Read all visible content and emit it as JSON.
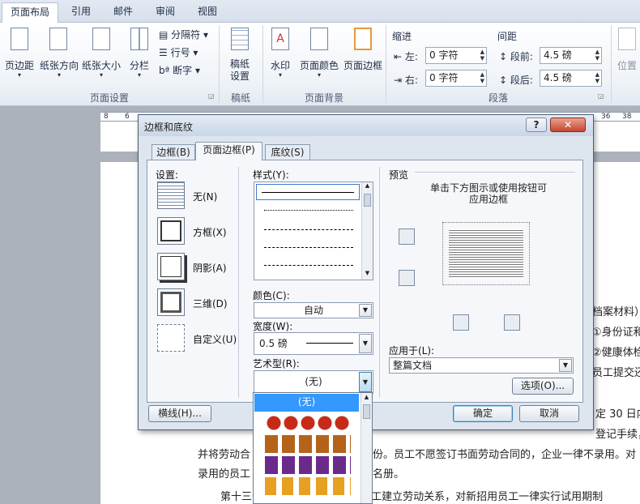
{
  "ribbon": {
    "tabs": [
      "页面布局",
      "引用",
      "邮件",
      "审阅",
      "视图"
    ],
    "groups": {
      "page_setup": {
        "label": "页面设置",
        "buttons": [
          "页边距",
          "纸张方向",
          "纸张大小",
          "分栏"
        ],
        "small": [
          "分隔符",
          "行号",
          "断字"
        ]
      },
      "manuscript": {
        "label": "稿纸",
        "button": "稿纸\n设置"
      },
      "page_background": {
        "label": "页面背景",
        "buttons": [
          "水印",
          "页面颜色",
          "页面边框"
        ]
      },
      "paragraph": {
        "label": "段落",
        "indent_label": "缩进",
        "spacing_label": "间距",
        "left_label": "左:",
        "left_value": "0 字符",
        "right_label": "右:",
        "right_value": "0 字符",
        "before_label": "段前:",
        "before_value": "4.5 磅",
        "after_label": "段后:",
        "after_value": "4.5 磅"
      },
      "arrange": {
        "button": "位置"
      }
    }
  },
  "ruler": {
    "left": [
      "8",
      "6"
    ],
    "right": [
      "36",
      "38"
    ]
  },
  "document": {
    "lines": [
      "档案材料）",
      "①身份证和",
      "②健康体检",
      "员工提交还",
      "定 30 日内",
      "登记手续，",
      "并将劳动合",
      "份。员工不愿签订书面劳动合同的，企业一律不录用。对",
      "录用的员工",
      "名册。",
      "第十三条  企业自用工之日起与员工建立劳动关系，对新招用员工一律实行试用期制"
    ]
  },
  "dialog": {
    "title": "边框和底纹",
    "help": "?",
    "close": "✕",
    "tabs": [
      "边框(B)",
      "页面边框(P)",
      "底纹(S)"
    ],
    "settings_label": "设置:",
    "settings": [
      "无(N)",
      "方框(X)",
      "阴影(A)",
      "三维(D)",
      "自定义(U)"
    ],
    "style_label": "样式(Y):",
    "color_label": "颜色(C):",
    "color_value": "自动",
    "width_label": "宽度(W):",
    "width_value": "0.5 磅",
    "art_label": "艺术型(R):",
    "art_value": "(无)",
    "art_dropdown_selected": "(无)",
    "preview_label": "预览",
    "preview_hint": "单击下方图示或使用按钮可\n应用边框",
    "apply_label": "应用于(L):",
    "apply_value": "整篇文档",
    "options_button": "选项(O)...",
    "hline_button": "横线(H)...",
    "ok_button": "确定",
    "cancel_button": "取消"
  },
  "colors": {
    "accent": "#3399ff",
    "dialog_bg": "#dde5ef",
    "ribbon_bg": "#eef2f7"
  }
}
